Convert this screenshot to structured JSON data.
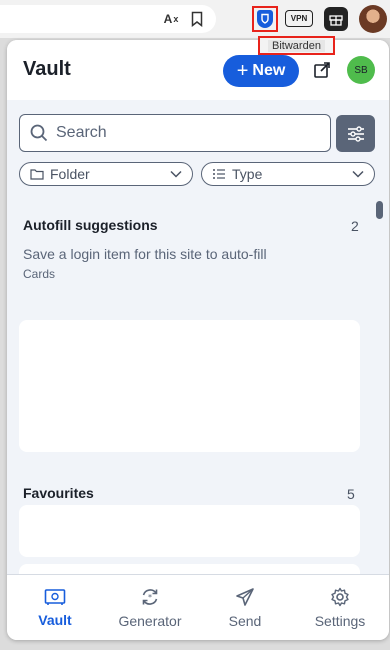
{
  "browser": {
    "translate_label": "A",
    "vpn_label": "VPN",
    "extension_tooltip": "Bitwarden"
  },
  "header": {
    "title": "Vault",
    "new_label": "New",
    "avatar_initials": "SB"
  },
  "search": {
    "placeholder": "Search"
  },
  "filters": {
    "folder_label": "Folder",
    "type_label": "Type"
  },
  "autofill": {
    "title": "Autofill suggestions",
    "count": "2",
    "hint": "Save a login item for this site to auto-fill",
    "sub_label": "Cards"
  },
  "favourites": {
    "title": "Favourites",
    "count": "5"
  },
  "nav": {
    "items": [
      {
        "label": "Vault",
        "icon": "vault-icon",
        "active": true
      },
      {
        "label": "Generator",
        "icon": "generator-icon",
        "active": false
      },
      {
        "label": "Send",
        "icon": "send-icon",
        "active": false
      },
      {
        "label": "Settings",
        "icon": "settings-icon",
        "active": false
      }
    ]
  },
  "colors": {
    "primary": "#175ddc",
    "highlight": "#e8231b",
    "avatar": "#4fbc4c",
    "content_bg": "#f1f4f9"
  }
}
